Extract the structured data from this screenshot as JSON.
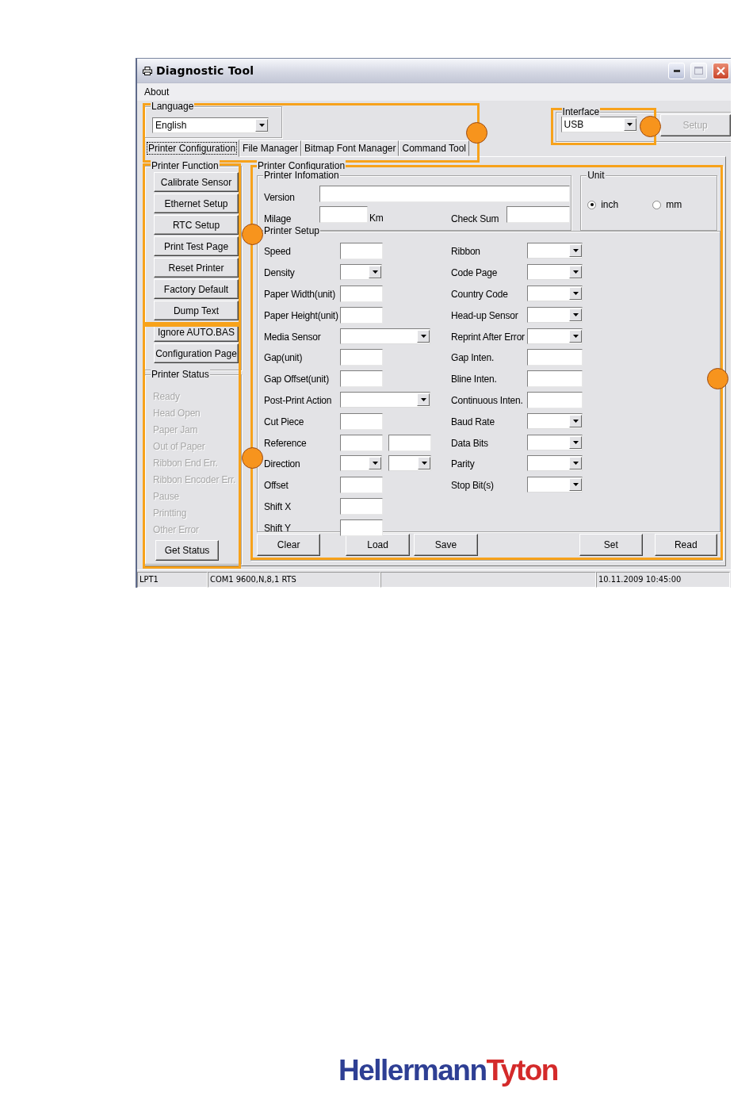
{
  "window": {
    "title": "Diagnostic Tool"
  },
  "menu": [
    "About"
  ],
  "language": {
    "label": "Language",
    "value": "English"
  },
  "interface": {
    "label": "Interface",
    "value": "USB",
    "setup_button": {
      "label": "Setup",
      "disabled": true
    }
  },
  "tabs": [
    {
      "label": "Printer Configuration",
      "selected": true
    },
    {
      "label": "File Manager",
      "selected": false
    },
    {
      "label": "Bitmap Font Manager",
      "selected": false
    },
    {
      "label": "Command Tool",
      "selected": false
    }
  ],
  "printer_function": {
    "label": "Printer Function",
    "buttons": [
      "Calibrate Sensor",
      "Ethernet Setup",
      "RTC Setup",
      "Print Test Page",
      "Reset Printer",
      "Factory Default",
      "Dump Text",
      "Ignore AUTO.BAS",
      "Configuration Page"
    ]
  },
  "printer_status": {
    "label": "Printer Status",
    "items": [
      {
        "text": "Ready",
        "disabled": true
      },
      {
        "text": "Head Open",
        "disabled": true
      },
      {
        "text": "Paper Jam",
        "disabled": true
      },
      {
        "text": "Out of Paper",
        "disabled": true
      },
      {
        "text": "Ribbon End Err.",
        "disabled": true
      },
      {
        "text": "Ribbon Encoder Err.",
        "disabled": true
      },
      {
        "text": "Pause",
        "disabled": true
      },
      {
        "text": "Printting",
        "disabled": true
      },
      {
        "text": "Other Error",
        "disabled": true
      }
    ],
    "button": "Get Status"
  },
  "printer_configuration": {
    "label": "Printer Configuration",
    "printer_information": {
      "label": "Printer Infomation",
      "version_label": "Version",
      "milage_label": "Milage",
      "milage_unit": "Km",
      "checksum_label": "Check Sum"
    },
    "unit": {
      "label": "Unit",
      "options": [
        {
          "label": "inch",
          "selected": true
        },
        {
          "label": "mm",
          "selected": false
        }
      ]
    },
    "printer_setup": {
      "label": "Printer Setup",
      "left": [
        {
          "label": "Speed",
          "kind": "input"
        },
        {
          "label": "Density",
          "kind": "dropdown"
        },
        {
          "label": "Paper Width(unit)",
          "kind": "input"
        },
        {
          "label": "Paper Height(unit)",
          "kind": "input"
        },
        {
          "label": "Media Sensor",
          "kind": "wide-dropdown"
        },
        {
          "label": "Gap(unit)",
          "kind": "input"
        },
        {
          "label": "Gap Offset(unit)",
          "kind": "input"
        },
        {
          "label": "Post-Print Action",
          "kind": "wide-dropdown"
        },
        {
          "label": "Cut Piece",
          "kind": "input"
        },
        {
          "label": "Reference",
          "kind": "input-pair"
        },
        {
          "label": "Direction",
          "kind": "dropdown-pair"
        },
        {
          "label": "Offset",
          "kind": "input"
        },
        {
          "label": "Shift X",
          "kind": "input"
        },
        {
          "label": "Shift Y",
          "kind": "input"
        }
      ],
      "right": [
        {
          "label": "Ribbon",
          "kind": "dropdown"
        },
        {
          "label": "Code Page",
          "kind": "dropdown"
        },
        {
          "label": "Country Code",
          "kind": "dropdown"
        },
        {
          "label": "Head-up Sensor",
          "kind": "dropdown"
        },
        {
          "label": "Reprint After Error",
          "kind": "dropdown"
        },
        {
          "label": "Gap Inten.",
          "kind": "input"
        },
        {
          "label": "Bline Inten.",
          "kind": "input"
        },
        {
          "label": "Continuous Inten.",
          "kind": "input"
        },
        {
          "label": "Baud Rate",
          "kind": "dropdown"
        },
        {
          "label": "Data Bits",
          "kind": "dropdown"
        },
        {
          "label": "Parity",
          "kind": "dropdown"
        },
        {
          "label": "Stop Bit(s)",
          "kind": "dropdown"
        }
      ]
    },
    "buttons_left": [
      "Clear",
      "Load",
      "Save"
    ],
    "buttons_right": [
      "Set",
      "Read"
    ]
  },
  "status_bar": [
    {
      "kind": "text",
      "text": "LPT1"
    },
    {
      "kind": "text",
      "text": "COM1 9600,N,8,1 RTS"
    },
    {
      "kind": "blank"
    },
    {
      "kind": "text",
      "text": "10.11.2009 10:45:00"
    }
  ],
  "footer_logo": [
    {
      "text": "Hellermann",
      "color": "#2e3f94"
    },
    {
      "text": "Tyton",
      "color": "#d42a2a"
    }
  ]
}
